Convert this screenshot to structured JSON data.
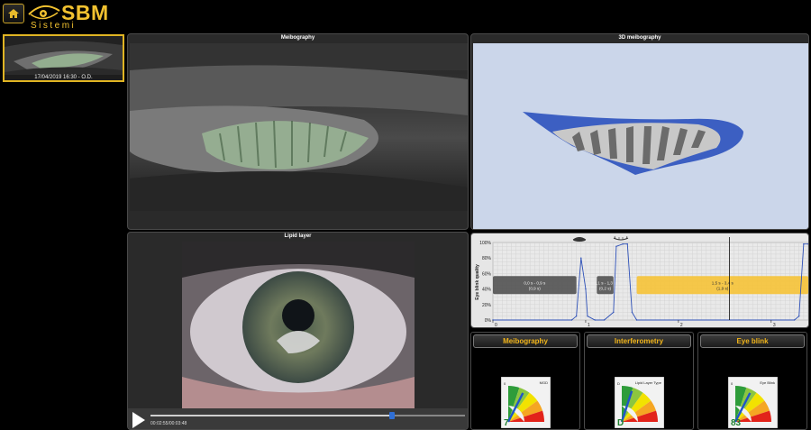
{
  "header": {
    "logo_main": "SBM",
    "logo_sub": "Sistemi"
  },
  "thumbnail": {
    "caption": "17/04/2019 16:30 - O.D."
  },
  "panels": {
    "meibography": {
      "title": "Meibography"
    },
    "meibography_3d": {
      "title": "3D meibography"
    },
    "lipid_layer": {
      "title": "Lipid layer"
    }
  },
  "player": {
    "time": "00:02:55/00:03:48",
    "progress": 0.767
  },
  "blink_chart": {
    "chart_data": {
      "type": "line",
      "ylabel": "Eye blink quality",
      "yticks": [
        "100%",
        "80%",
        "60%",
        "40%",
        "20%",
        "0%"
      ],
      "xticks": [
        "0",
        "1",
        "2",
        "3"
      ],
      "xlim": [
        0,
        3.4
      ],
      "ylim": [
        0,
        100
      ],
      "series": [
        {
          "x": [
            0,
            0.85,
            0.9,
            0.95,
            1.0,
            1.02,
            1.1,
            1.2,
            1.3,
            1.33,
            1.4,
            1.45,
            1.5,
            1.55,
            3.25,
            3.3,
            3.35,
            3.4
          ],
          "y": [
            0,
            0,
            5,
            80,
            40,
            5,
            0,
            0,
            10,
            95,
            98,
            98,
            10,
            0,
            0,
            5,
            98,
            98
          ]
        }
      ],
      "intervals": [
        {
          "label": "0,0 s - 0,9 s",
          "sublabel": "(0,9 s)",
          "start": 0.0,
          "end": 0.9,
          "color": "#555555"
        },
        {
          "label": "1,1 s - 1,3 s",
          "sublabel": "(0,2 s)",
          "start": 1.12,
          "end": 1.3,
          "color": "#555555"
        },
        {
          "label": "1,5 s - 3,4 s",
          "sublabel": "(1,9 s)",
          "start": 1.55,
          "end": 3.4,
          "color": "#f5c33b"
        }
      ],
      "cursor_x": 2.55
    }
  },
  "summaries": [
    {
      "title": "Meibography",
      "gauge_label": "MGD",
      "value": "7",
      "level": 0.3,
      "scale_min": "0"
    },
    {
      "title": "Interferometry",
      "gauge_label": "Lipid Layer Type",
      "value": "D",
      "level": 0.2,
      "scale_min": "D"
    },
    {
      "title": "Eye blink",
      "gauge_label": "Eye Blink",
      "value": "83",
      "level": 0.3,
      "scale_min": "0"
    }
  ]
}
